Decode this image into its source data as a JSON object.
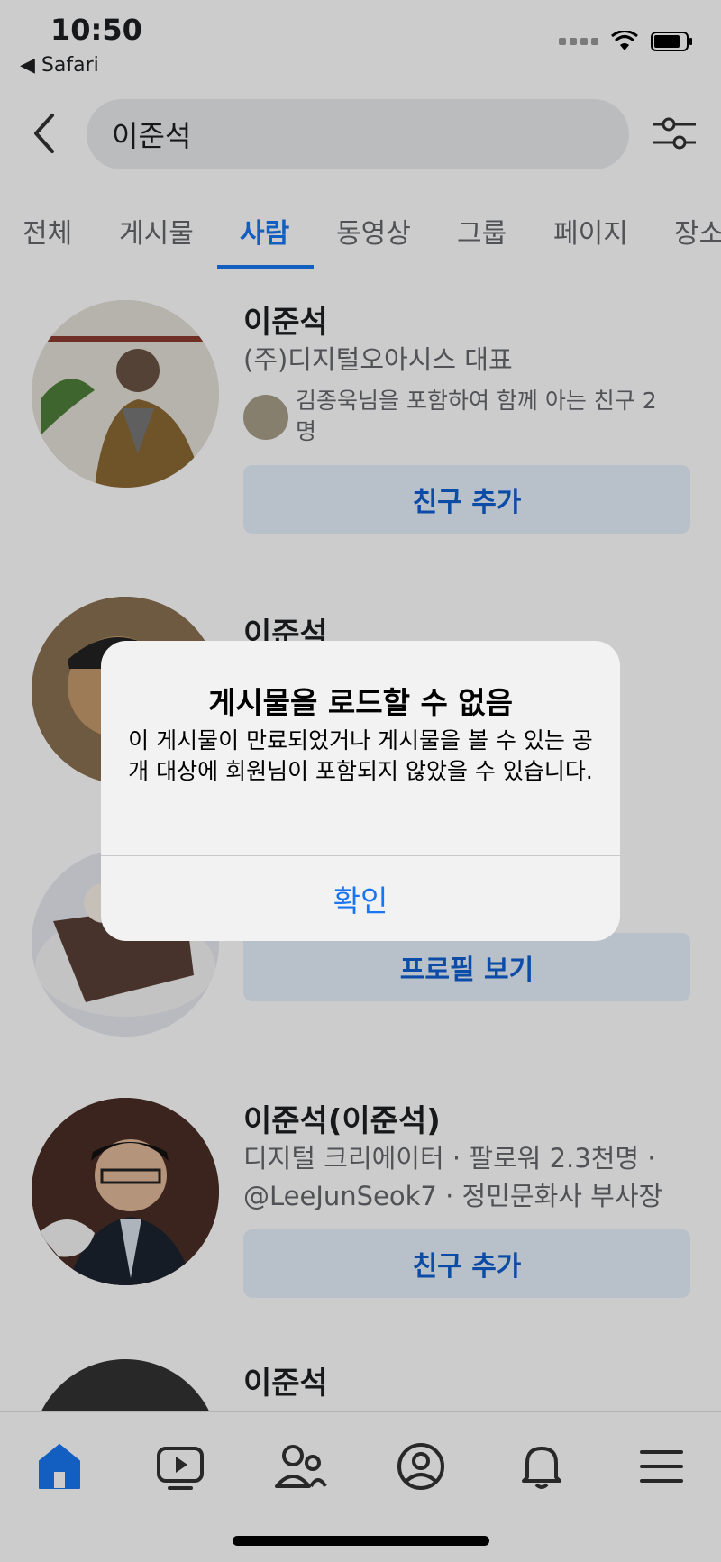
{
  "status_bar": {
    "time": "10:50",
    "back_app": "◀ Safari"
  },
  "search": {
    "query": "이준석"
  },
  "tabs": [
    "전체",
    "게시물",
    "사람",
    "동영상",
    "그룹",
    "페이지",
    "장소"
  ],
  "results": [
    {
      "name": "이준석",
      "subtitle": "(주)디지털오아시스 대표",
      "mutual_line1": "김종욱님을 포함하여 함께 아는 친구 2",
      "mutual_line2": "명",
      "button": "친구 추가"
    },
    {
      "name": "이준석"
    },
    {
      "button": "프로필 보기"
    },
    {
      "name": "이준석(이준석)",
      "subtitle_line1": "디지털 크리에이터 · 팔로워 2.3천명 ·",
      "subtitle_line2": "@LeeJunSeok7 · 정민문화사 부사장",
      "button": "친구 추가"
    },
    {
      "name": "이준석"
    }
  ],
  "alert": {
    "title": "게시물을 로드할 수 없음",
    "message": "이 게시물이 만료되었거나 게시물을 볼 수 있는 공개 대상에 회원님이 포함되지 않았을 수 있습니다.",
    "button": "확인"
  },
  "colors": {
    "accent": "#1876f2",
    "button_bg": "#e7f0fd",
    "dim": "rgba(0,0,0,0.2)"
  },
  "nav_icons": [
    "home-icon",
    "video-icon",
    "friends-icon",
    "profile-icon",
    "bell-icon",
    "menu-icon"
  ]
}
